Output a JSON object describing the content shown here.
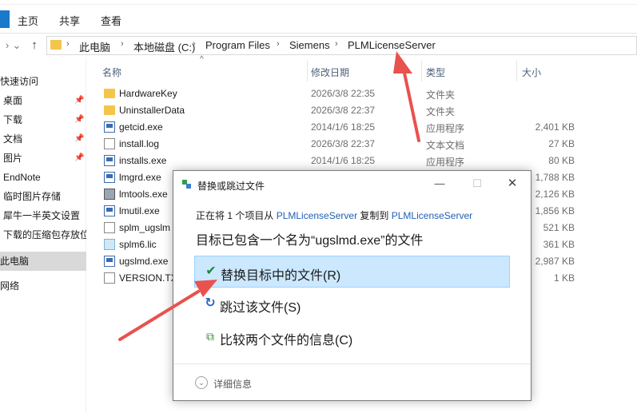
{
  "ribbon": {
    "tabs": [
      "主页",
      "共享",
      "查看"
    ]
  },
  "address": {
    "crumbs": [
      "此电脑",
      "本地磁盘 (C:)",
      "Program Files",
      "Siemens",
      "PLMLicenseServer"
    ]
  },
  "sidebar": {
    "items": [
      {
        "label": "快速访问",
        "pinned": false
      },
      {
        "label": "桌面",
        "pinned": true
      },
      {
        "label": "下载",
        "pinned": true
      },
      {
        "label": "文档",
        "pinned": true
      },
      {
        "label": "图片",
        "pinned": true
      },
      {
        "label": "EndNote",
        "pinned": false
      },
      {
        "label": "临时图片存储",
        "pinned": false
      },
      {
        "label": "犀牛一半英文设置",
        "pinned": false
      },
      {
        "label": "下载的压缩包存放位",
        "pinned": false
      },
      {
        "label": "此电脑",
        "pinned": false,
        "selected": true
      },
      {
        "label": "网络",
        "pinned": false
      }
    ]
  },
  "columns": {
    "name": "名称",
    "date": "修改日期",
    "type": "类型",
    "size": "大小"
  },
  "files": [
    {
      "name": "HardwareKey",
      "date": "2026/3/8 22:35",
      "type": "文件夹",
      "size": "",
      "icon": "folder"
    },
    {
      "name": "UninstallerData",
      "date": "2026/3/8 22:37",
      "type": "文件夹",
      "size": "",
      "icon": "folder"
    },
    {
      "name": "getcid.exe",
      "date": "2014/1/6 18:25",
      "type": "应用程序",
      "size": "2,401 KB",
      "icon": "exe"
    },
    {
      "name": "install.log",
      "date": "2026/3/8 22:37",
      "type": "文本文档",
      "size": "27 KB",
      "icon": "doc"
    },
    {
      "name": "installs.exe",
      "date": "2014/1/6 18:25",
      "type": "应用程序",
      "size": "80 KB",
      "icon": "exe"
    },
    {
      "name": "lmgrd.exe",
      "date": "",
      "type": "",
      "size": "1,788 KB",
      "icon": "exe"
    },
    {
      "name": "lmtools.exe",
      "date": "",
      "type": "",
      "size": "2,126 KB",
      "icon": "gear"
    },
    {
      "name": "lmutil.exe",
      "date": "",
      "type": "",
      "size": "1,856 KB",
      "icon": "exe"
    },
    {
      "name": "splm_ugslm",
      "date": "",
      "type": "",
      "size": "521 KB",
      "icon": "doc"
    },
    {
      "name": "splm6.lic",
      "date": "",
      "type": "",
      "size": "361 KB",
      "icon": "lic"
    },
    {
      "name": "ugslmd.exe",
      "date": "",
      "type": "",
      "size": "2,987 KB",
      "icon": "exe"
    },
    {
      "name": "VERSION.TX",
      "date": "",
      "type": "",
      "size": "1 KB",
      "icon": "doc"
    }
  ],
  "dialog": {
    "title": "替换或跳过文件",
    "line_prefix": "正在将 1 个项目从 ",
    "source": "PLMLicenseServer",
    "line_middle": " 复制到 ",
    "target": "PLMLicenseServer",
    "heading": "目标已包含一个名为“ugslmd.exe”的文件",
    "options": [
      {
        "label": "替换目标中的文件(R)",
        "icon": "checkmark-icon",
        "highlighted": true
      },
      {
        "label": "跳过该文件(S)",
        "icon": "skip-icon",
        "highlighted": false
      },
      {
        "label": "比较两个文件的信息(C)",
        "icon": "compare-icon",
        "highlighted": false
      }
    ],
    "details_label": "详细信息"
  },
  "colors": {
    "annotation_arrow": "#e8524f",
    "highlight_bg": "#cce8ff",
    "link": "#1f5fb5"
  }
}
